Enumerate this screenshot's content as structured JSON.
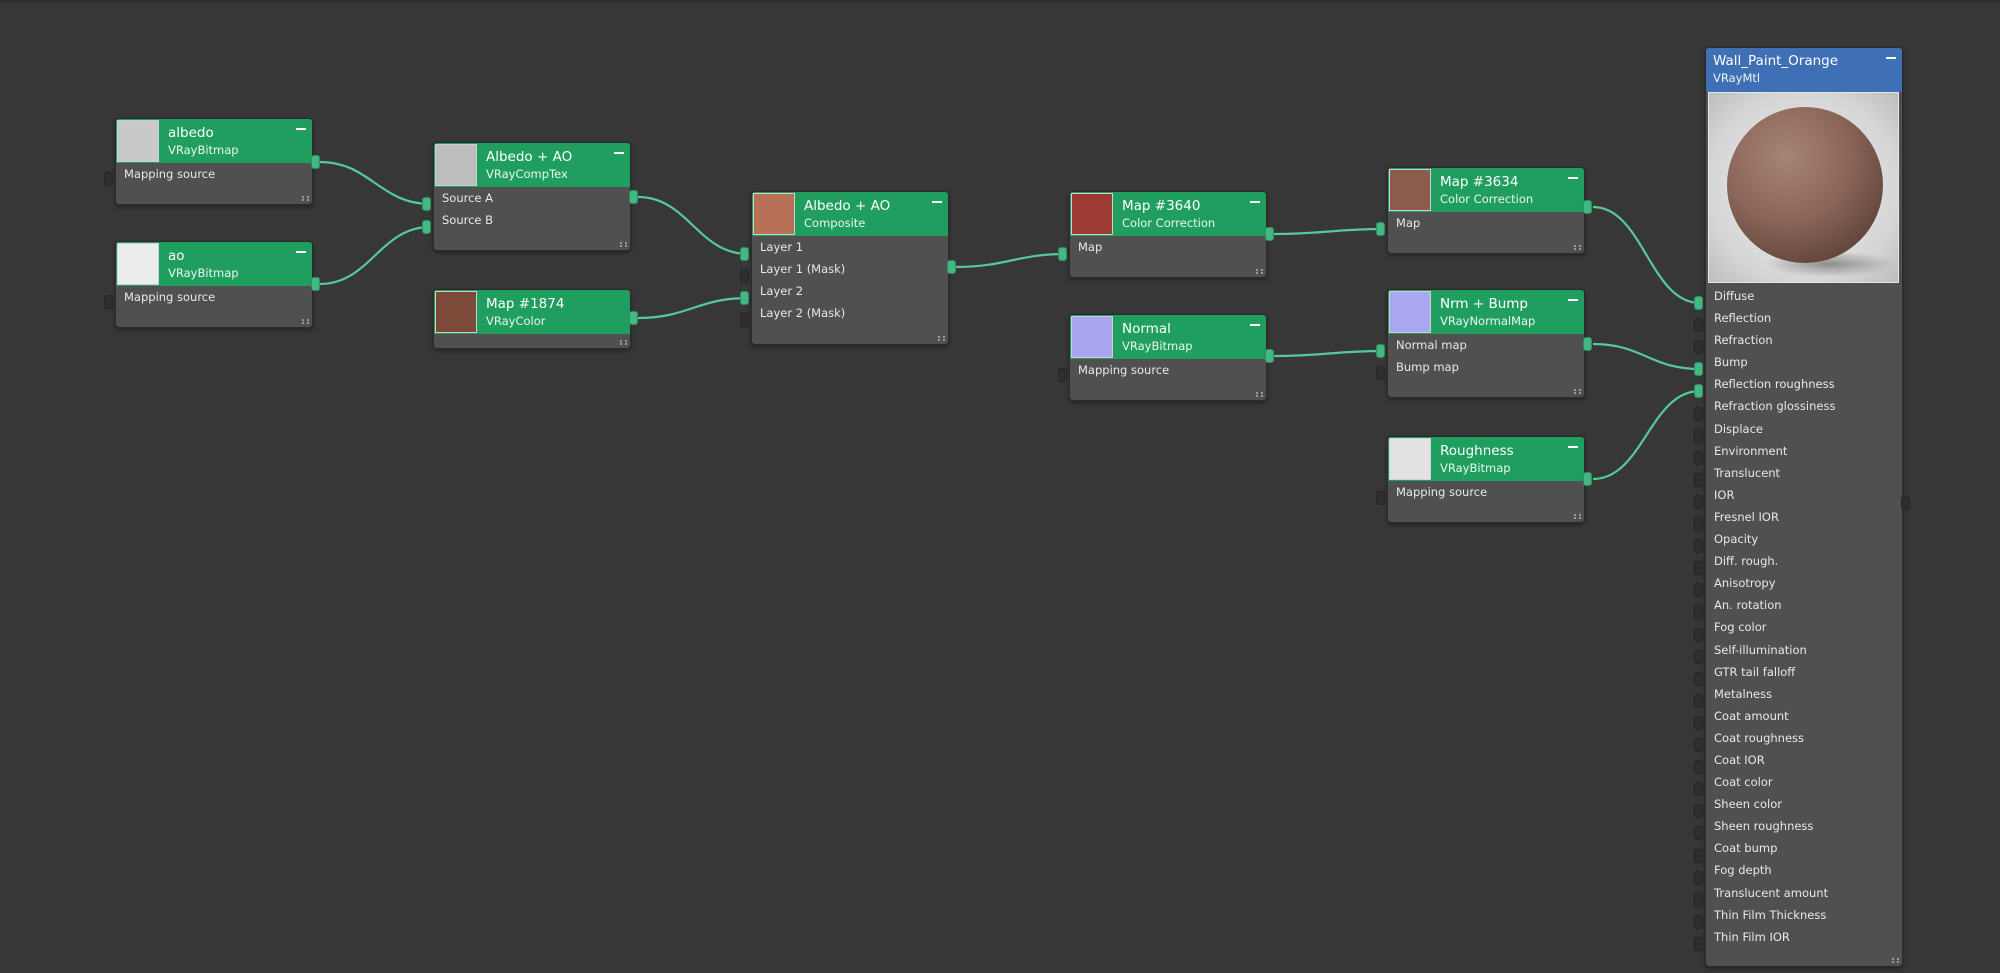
{
  "colors": {
    "background": "#373737",
    "node_header": "#1f9e5f",
    "material_header": "#3f6fb5",
    "node_body": "#505050",
    "wire": "#56c99a"
  },
  "nodes": {
    "albedo": {
      "title": "albedo",
      "type": "VRayBitmap",
      "thumb": "#c9c9c9",
      "rows": [
        "Mapping source"
      ]
    },
    "ao": {
      "title": "ao",
      "type": "VRayBitmap",
      "thumb": "#ececec",
      "rows": [
        "Mapping source"
      ]
    },
    "comptex": {
      "title": "Albedo + AO",
      "type": "VRayCompTex",
      "thumb": "#bdbdbd",
      "rows": [
        "Source A",
        "Source B"
      ]
    },
    "color1874": {
      "title": "Map #1874",
      "type": "VRayColor",
      "thumb": "#7d4a3a",
      "rows": []
    },
    "composite": {
      "title": "Albedo + AO",
      "type": "Composite",
      "thumb": "#b76f55",
      "rows": [
        "Layer 1",
        "Layer 1 (Mask)",
        "Layer 2",
        "Layer 2 (Mask)"
      ]
    },
    "cc3640": {
      "title": "Map #3640",
      "type": "Color Correction",
      "thumb": "#9b3b32",
      "rows": [
        "Map"
      ]
    },
    "normal": {
      "title": "Normal",
      "type": "VRayBitmap",
      "thumb": "#a8a4f0",
      "rows": [
        "Mapping source"
      ]
    },
    "cc3634": {
      "title": "Map #3634",
      "type": "Color Correction",
      "thumb": "#8a5c4c",
      "rows": [
        "Map"
      ]
    },
    "nrmbump": {
      "title": "Nrm + Bump",
      "type": "VRayNormalMap",
      "thumb": "#a9a6f2",
      "rows": [
        "Normal map",
        "Bump map"
      ]
    },
    "roughness": {
      "title": "Roughness",
      "type": "VRayBitmap",
      "thumb": "#e2e2e2",
      "rows": [
        "Mapping source"
      ]
    }
  },
  "material": {
    "title": "Wall_Paint_Orange",
    "type": "VRayMtl",
    "slots": [
      "Diffuse",
      "Reflection",
      "Refraction",
      "Bump",
      "Reflection roughness",
      "Refraction glossiness",
      "Displace",
      "Environment",
      "Translucent",
      "IOR",
      "Fresnel IOR",
      "Opacity",
      "Diff. rough.",
      "Anisotropy",
      "An. rotation",
      "Fog color",
      "Self-illumination",
      "GTR tail falloff",
      "Metalness",
      "Coat amount",
      "Coat roughness",
      "Coat IOR",
      "Coat color",
      "Sheen color",
      "Sheen roughness",
      "Coat bump",
      "Fog depth",
      "Translucent amount",
      "Thin Film Thickness",
      "Thin Film IOR"
    ],
    "connected_slots": [
      "Diffuse",
      "Bump",
      "Reflection roughness"
    ]
  }
}
